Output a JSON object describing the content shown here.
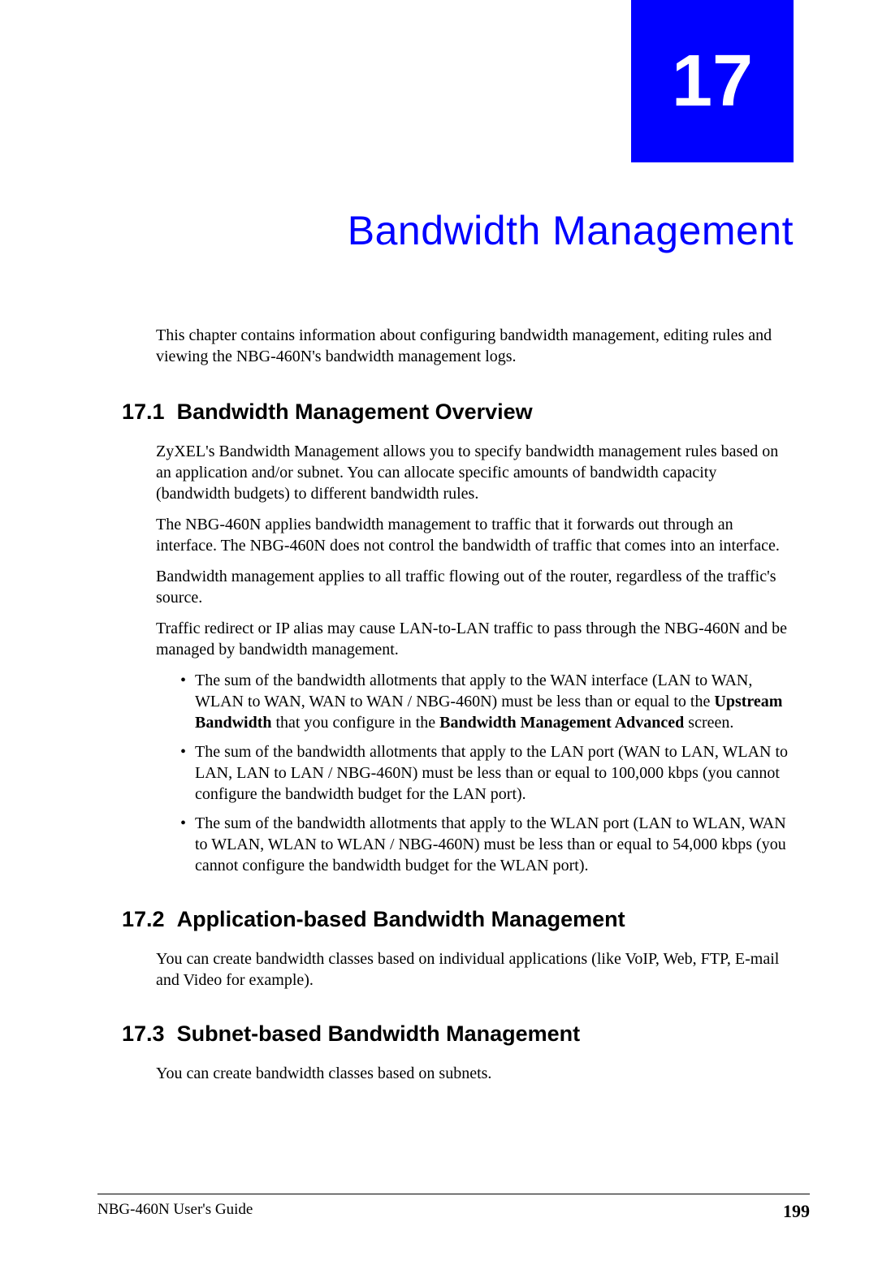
{
  "chapter": {
    "number": "17",
    "title": "Bandwidth Management"
  },
  "intro": "This chapter contains information about configuring bandwidth management, editing rules and viewing the NBG-460N's bandwidth management logs.",
  "sections": [
    {
      "number": "17.1",
      "title": "Bandwidth Management Overview",
      "paragraphs": [
        "ZyXEL's Bandwidth Management allows you to specify bandwidth management rules based on an application and/or subnet. You can allocate specific amounts of bandwidth capacity (bandwidth budgets) to different bandwidth rules.",
        "The NBG-460N applies bandwidth management to traffic that it forwards out through an interface. The NBG-460N does not control the bandwidth of traffic that comes into an interface.",
        "Bandwidth management applies to all traffic flowing out of the router, regardless of the traffic's source.",
        "Traffic redirect or IP alias may cause LAN-to-LAN traffic to pass through the NBG-460N and be managed by bandwidth management."
      ],
      "bullets": [
        {
          "pre": "The sum of the bandwidth allotments that apply to the WAN interface (LAN to WAN, WLAN to WAN, WAN to WAN / NBG-460N) must be less than or equal to the ",
          "bold1": "Upstream Bandwidth",
          "mid": " that you configure in the ",
          "bold2": "Bandwidth Management Advanced",
          "post": " screen."
        },
        {
          "text": "The sum of the bandwidth allotments that apply to the LAN port (WAN to LAN, WLAN to LAN, LAN to LAN / NBG-460N) must be less than or equal to 100,000 kbps (you cannot configure the bandwidth budget for the LAN port)."
        },
        {
          "text": "The sum of the bandwidth allotments that apply to the WLAN port (LAN to WLAN, WAN to WLAN, WLAN to WLAN / NBG-460N) must be less than or equal to 54,000 kbps (you cannot configure the bandwidth budget for the WLAN port)."
        }
      ]
    },
    {
      "number": "17.2",
      "title": "Application-based Bandwidth Management",
      "paragraphs": [
        "You can create bandwidth classes based on individual applications (like VoIP, Web, FTP, E-mail and Video for example)."
      ]
    },
    {
      "number": "17.3",
      "title": "Subnet-based Bandwidth Management",
      "paragraphs": [
        "You can create bandwidth classes based on subnets."
      ]
    }
  ],
  "footer": {
    "left": "NBG-460N User's Guide",
    "right": "199"
  },
  "chart_data": null
}
